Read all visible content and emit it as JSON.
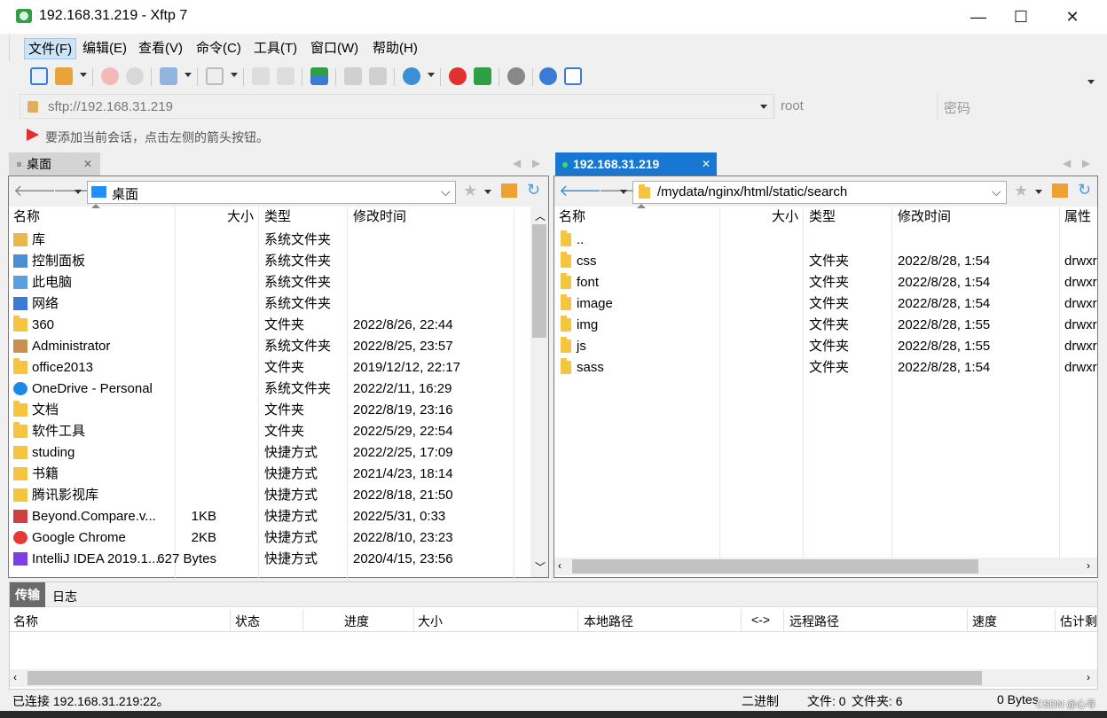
{
  "window": {
    "title": "192.168.31.219 - Xftp 7",
    "minimize": "—",
    "maximize": "☐",
    "close": "✕"
  },
  "menu": {
    "items": [
      "文件(F)",
      "编辑(E)",
      "查看(V)",
      "命令(C)",
      "工具(T)",
      "窗口(W)",
      "帮助(H)"
    ]
  },
  "address": {
    "url": "sftp://192.168.31.219",
    "user": "root",
    "password_placeholder": "密码"
  },
  "hint": "要添加当前会话，点击左侧的箭头按钮。",
  "left": {
    "tab": "桌面",
    "path": "桌面",
    "columns": [
      "名称",
      "大小",
      "类型",
      "修改时间"
    ],
    "rows": [
      {
        "name": "库",
        "size": "",
        "type": "系统文件夹",
        "modified": "",
        "icon": "library-icon"
      },
      {
        "name": "控制面板",
        "size": "",
        "type": "系统文件夹",
        "modified": "",
        "icon": "control-panel-icon"
      },
      {
        "name": "此电脑",
        "size": "",
        "type": "系统文件夹",
        "modified": "",
        "icon": "computer-icon"
      },
      {
        "name": "网络",
        "size": "",
        "type": "系统文件夹",
        "modified": "",
        "icon": "network-icon"
      },
      {
        "name": "360",
        "size": "",
        "type": "文件夹",
        "modified": "2022/8/26, 22:44",
        "icon": "folder-icon"
      },
      {
        "name": "Administrator",
        "size": "",
        "type": "系统文件夹",
        "modified": "2022/8/25, 23:57",
        "icon": "user-icon"
      },
      {
        "name": "office2013",
        "size": "",
        "type": "文件夹",
        "modified": "2019/12/12, 22:17",
        "icon": "folder-icon"
      },
      {
        "name": "OneDrive - Personal",
        "size": "",
        "type": "系统文件夹",
        "modified": "2022/2/11, 16:29",
        "icon": "cloud-icon"
      },
      {
        "name": "文档",
        "size": "",
        "type": "文件夹",
        "modified": "2022/8/19, 23:16",
        "icon": "folder-icon"
      },
      {
        "name": "软件工具",
        "size": "",
        "type": "文件夹",
        "modified": "2022/5/29, 22:54",
        "icon": "folder-icon"
      },
      {
        "name": "studing",
        "size": "",
        "type": "快捷方式",
        "modified": "2022/2/25, 17:09",
        "icon": "shortcut-icon"
      },
      {
        "name": "书籍",
        "size": "",
        "type": "快捷方式",
        "modified": "2021/4/23, 18:14",
        "icon": "shortcut-icon"
      },
      {
        "name": "腾讯影视库",
        "size": "",
        "type": "快捷方式",
        "modified": "2022/8/18, 21:50",
        "icon": "video-icon"
      },
      {
        "name": "Beyond.Compare.v...",
        "size": "1KB",
        "type": "快捷方式",
        "modified": "2022/5/31, 0:33",
        "icon": "app-shortcut-icon"
      },
      {
        "name": "Google Chrome",
        "size": "2KB",
        "type": "快捷方式",
        "modified": "2022/8/10, 23:23",
        "icon": "chrome-icon"
      },
      {
        "name": "IntelliJ IDEA 2019.1....",
        "size": "627 Bytes",
        "type": "快捷方式",
        "modified": "2020/4/15, 23:56",
        "icon": "idea-icon"
      }
    ]
  },
  "right": {
    "tab": "192.168.31.219",
    "path": "/mydata/nginx/html/static/search",
    "columns": [
      "名称",
      "大小",
      "类型",
      "修改时间",
      "属性"
    ],
    "rows": [
      {
        "name": "..",
        "type": "",
        "modified": "",
        "attr": ""
      },
      {
        "name": "css",
        "type": "文件夹",
        "modified": "2022/8/28, 1:54",
        "attr": "drwxr"
      },
      {
        "name": "font",
        "type": "文件夹",
        "modified": "2022/8/28, 1:54",
        "attr": "drwxr"
      },
      {
        "name": "image",
        "type": "文件夹",
        "modified": "2022/8/28, 1:54",
        "attr": "drwxr"
      },
      {
        "name": "img",
        "type": "文件夹",
        "modified": "2022/8/28, 1:55",
        "attr": "drwxr"
      },
      {
        "name": "js",
        "type": "文件夹",
        "modified": "2022/8/28, 1:55",
        "attr": "drwxr"
      },
      {
        "name": "sass",
        "type": "文件夹",
        "modified": "2022/8/28, 1:54",
        "attr": "drwxr"
      }
    ]
  },
  "transfer": {
    "tabs": [
      "传输",
      "日志"
    ],
    "columns": [
      "名称",
      "状态",
      "进度",
      "大小",
      "本地路径",
      "<->",
      "远程路径",
      "速度",
      "估计剩"
    ]
  },
  "status": {
    "connected": "已连接 192.168.31.219:22。",
    "mode": "二进制",
    "files": "文件: 0",
    "folders": "文件夹: 6",
    "bytes": "0 Bytes",
    "watermark": "CSDN @心寻"
  }
}
